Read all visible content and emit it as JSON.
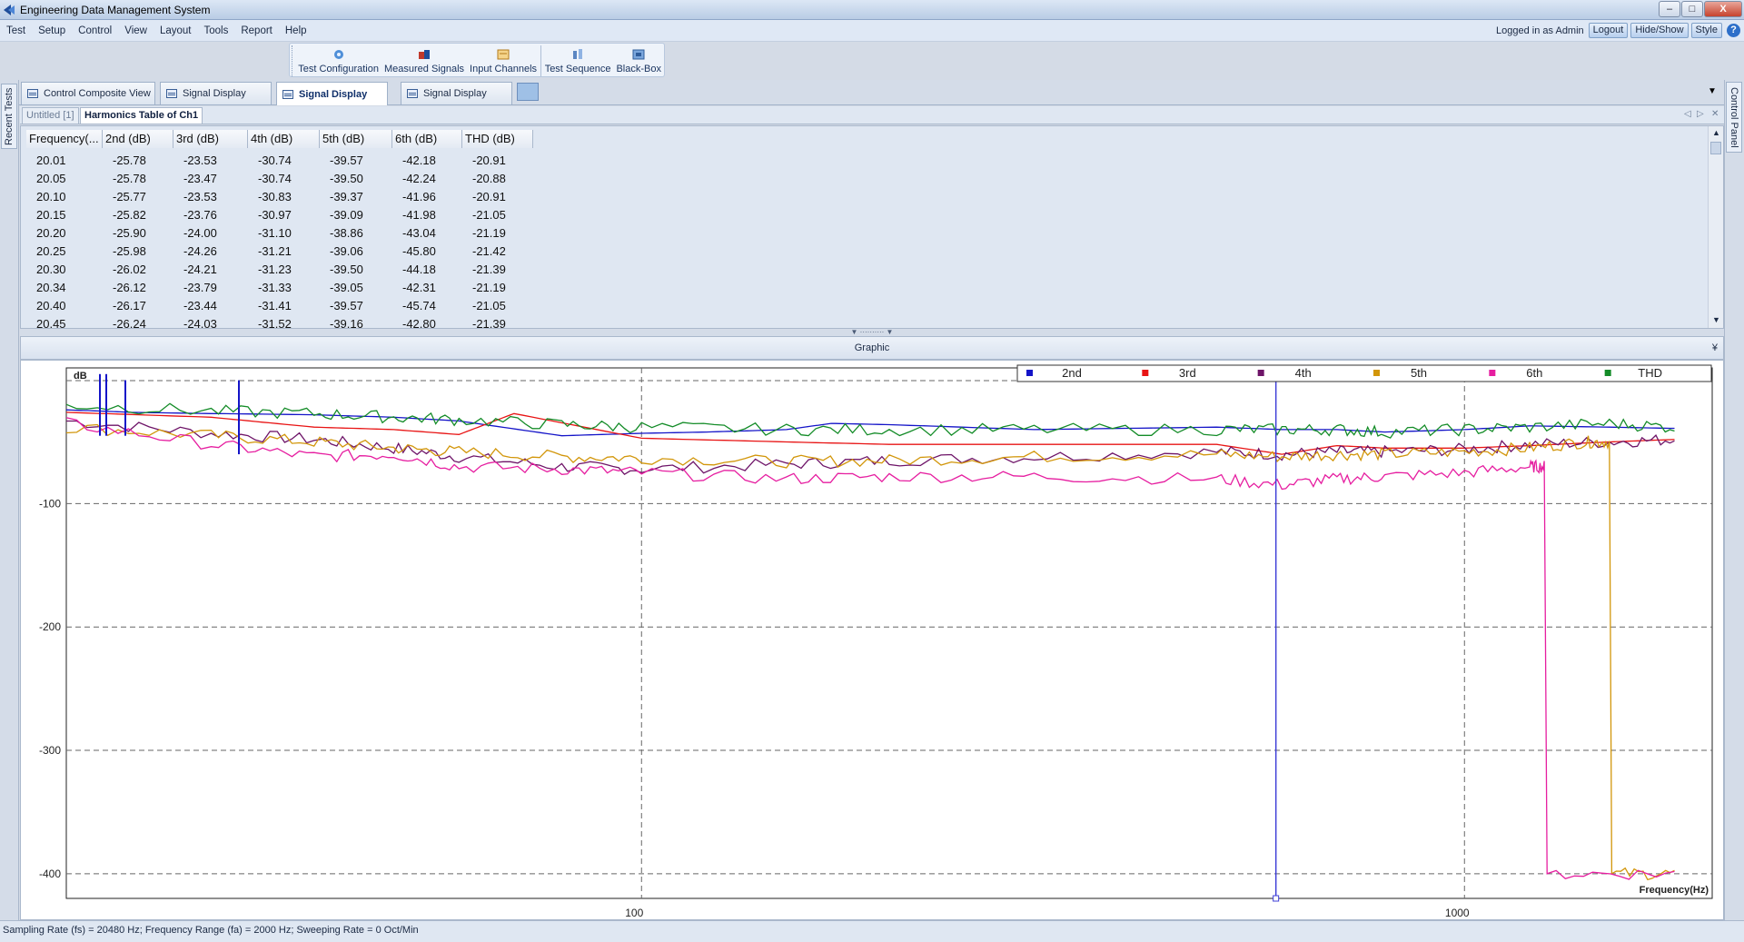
{
  "window": {
    "title": "Engineering Data Management System",
    "min": "–",
    "max": "□",
    "close": "X"
  },
  "menu": [
    "Test",
    "Setup",
    "Control",
    "View",
    "Layout",
    "Tools",
    "Report",
    "Help"
  ],
  "login": {
    "text": "Logged in as Admin",
    "logout": "Logout",
    "hide_show": "Hide/Show",
    "style": "Style",
    "help": "?"
  },
  "toolbar": [
    {
      "label": "Test Configuration",
      "icon": "settings-icon"
    },
    {
      "label": "Measured Signals",
      "icon": "signals-icon"
    },
    {
      "label": "Input Channels",
      "icon": "channels-icon"
    },
    {
      "label": "Test Sequence",
      "icon": "sequence-icon"
    },
    {
      "label": "Black-Box",
      "icon": "blackbox-icon"
    }
  ],
  "side": {
    "left": "Recent Tests",
    "right": "Control Panel"
  },
  "doc_tabs": [
    "Control Composite View",
    "Signal Display",
    "Signal Display",
    "Signal Display"
  ],
  "sub_tabs": [
    "Untitled [1]",
    "Harmonics Table of Ch1"
  ],
  "table": {
    "headers": [
      "Frequency(...",
      "2nd (dB)",
      "3rd (dB)",
      "4th (dB)",
      "5th (dB)",
      "6th (dB)",
      "THD (dB)"
    ],
    "rows": [
      [
        "20.01",
        "-25.78",
        "-23.53",
        "-30.74",
        "-39.57",
        "-42.18",
        "-20.91"
      ],
      [
        "20.05",
        "-25.78",
        "-23.47",
        "-30.74",
        "-39.50",
        "-42.24",
        "-20.88"
      ],
      [
        "20.10",
        "-25.77",
        "-23.53",
        "-30.83",
        "-39.37",
        "-41.96",
        "-20.91"
      ],
      [
        "20.15",
        "-25.82",
        "-23.76",
        "-30.97",
        "-39.09",
        "-41.98",
        "-21.05"
      ],
      [
        "20.20",
        "-25.90",
        "-24.00",
        "-31.10",
        "-38.86",
        "-43.04",
        "-21.19"
      ],
      [
        "20.25",
        "-25.98",
        "-24.26",
        "-31.21",
        "-39.06",
        "-45.80",
        "-21.42"
      ],
      [
        "20.30",
        "-26.02",
        "-24.21",
        "-31.23",
        "-39.50",
        "-44.18",
        "-21.39"
      ],
      [
        "20.34",
        "-26.12",
        "-23.79",
        "-31.33",
        "-39.05",
        "-42.31",
        "-21.19"
      ],
      [
        "20.40",
        "-26.17",
        "-23.44",
        "-31.41",
        "-39.57",
        "-45.74",
        "-21.05"
      ],
      [
        "20.45",
        "-26.24",
        "-24.03",
        "-31.52",
        "-39.16",
        "-42.80",
        "-21.39"
      ]
    ]
  },
  "graphic": {
    "title": "Graphic"
  },
  "chart_data": {
    "type": "line",
    "title": "",
    "xlabel": "Frequency(Hz)",
    "ylabel": "dB",
    "x_scale": "log",
    "xlim": [
      20,
      2000
    ],
    "ylim": [
      -420,
      10
    ],
    "x_ticks": [
      100,
      1000
    ],
    "y_ticks": [
      -100,
      -200,
      -300,
      -400
    ],
    "grid": true,
    "legend_position": "top-right",
    "cursor_x": 590,
    "series": [
      {
        "name": "2nd",
        "color": "#1414c8",
        "x": [
          20,
          22,
          24,
          30,
          40,
          50,
          60,
          80,
          100,
          120,
          150,
          170,
          200,
          300,
          500,
          600,
          700,
          800,
          1000,
          1200,
          1500,
          1800
        ],
        "y": [
          -24,
          -25,
          -26,
          -27,
          -28,
          -30,
          -33,
          -45,
          -43,
          -42,
          -40,
          -35,
          -36,
          -40,
          -38,
          -40,
          -40,
          -42,
          -40,
          -37,
          -38,
          -39
        ]
      },
      {
        "name": "3rd",
        "color": "#e81414",
        "x": [
          20,
          30,
          40,
          50,
          60,
          70,
          100,
          150,
          200,
          300,
          500,
          600,
          700,
          800,
          1000,
          1200,
          1500,
          1800
        ],
        "y": [
          -26,
          -30,
          -38,
          -40,
          -44,
          -27,
          -47,
          -50,
          -52,
          -52,
          -52,
          -60,
          -53,
          -55,
          -55,
          -53,
          -50,
          -48
        ]
      },
      {
        "name": "4th",
        "color": "#6e1468",
        "x": [
          20,
          30,
          40,
          50,
          60,
          80,
          100,
          150,
          200,
          300,
          500,
          600,
          700,
          800,
          1000,
          1200,
          1500,
          1800
        ],
        "y": [
          -33,
          -43,
          -48,
          -55,
          -62,
          -70,
          -72,
          -68,
          -65,
          -62,
          -58,
          -60,
          -58,
          -58,
          -56,
          -52,
          -50,
          -48
        ]
      },
      {
        "name": "5th",
        "color": "#d2960a",
        "x": [
          20,
          30,
          40,
          50,
          60,
          80,
          100,
          150,
          200,
          300,
          500,
          600,
          700,
          800,
          1000,
          1200,
          1400,
          1500,
          1510,
          1800
        ],
        "y": [
          -38,
          -45,
          -50,
          -55,
          -58,
          -62,
          -63,
          -66,
          -65,
          -62,
          -60,
          -62,
          -60,
          -60,
          -58,
          -55,
          -50,
          -50,
          -400,
          -400
        ]
      },
      {
        "name": "6th",
        "color": "#e61ea0",
        "x": [
          20,
          30,
          40,
          50,
          60,
          80,
          100,
          150,
          200,
          300,
          500,
          600,
          700,
          800,
          1000,
          1200,
          1250,
          1260,
          1800
        ],
        "y": [
          -35,
          -52,
          -62,
          -60,
          -70,
          -72,
          -75,
          -80,
          -78,
          -78,
          -80,
          -85,
          -80,
          -78,
          -75,
          -70,
          -70,
          -400,
          -400
        ]
      },
      {
        "name": "THD",
        "color": "#148c28",
        "x": [
          20,
          30,
          40,
          50,
          60,
          80,
          100,
          150,
          200,
          300,
          500,
          600,
          700,
          800,
          1000,
          1200,
          1500,
          1800
        ],
        "y": [
          -20,
          -25,
          -27,
          -30,
          -32,
          -36,
          -38,
          -40,
          -40,
          -40,
          -40,
          -40,
          -40,
          -42,
          -40,
          -38,
          -35,
          -38
        ]
      }
    ]
  },
  "status": "Sampling Rate (fs) = 20480 Hz; Frequency Range (fa) =  2000 Hz; Sweeping Rate = 0 Oct/Min"
}
